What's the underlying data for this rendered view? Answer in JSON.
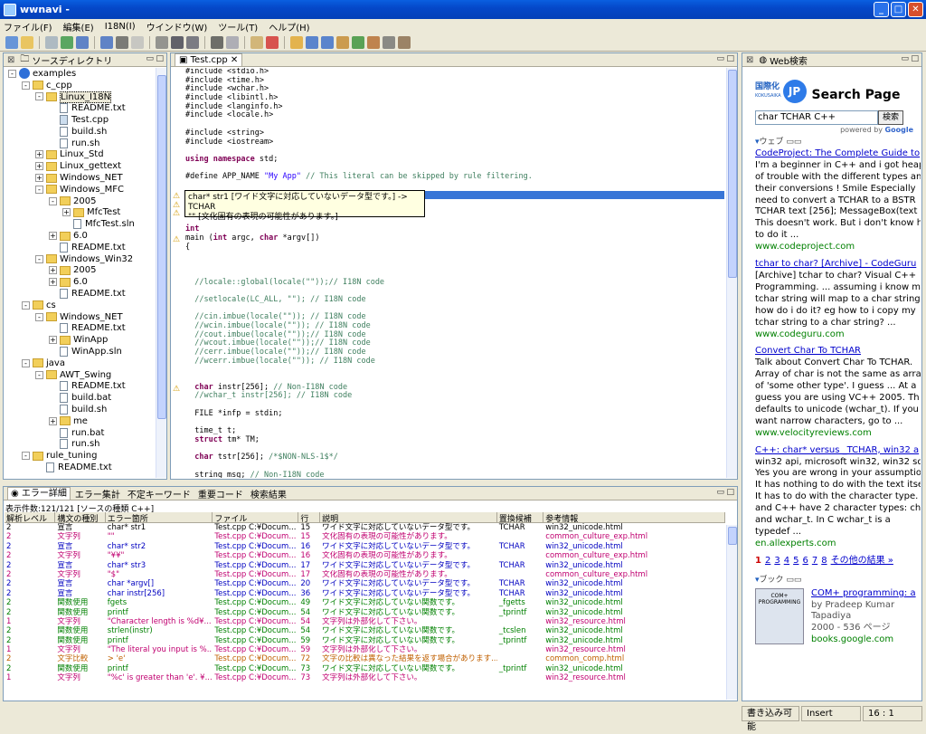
{
  "window": {
    "title": "wwnavi - "
  },
  "menu": [
    "ファイル(F)",
    "編集(E)",
    "I18N(I)",
    "ウインドウ(W)",
    "ツール(T)",
    "ヘルプ(H)"
  ],
  "toolbar_icons": [
    "new-icon",
    "open-icon",
    "save-icon",
    "refresh-icon",
    "redo-icon",
    "undo-icon",
    "binoculars-icon",
    "stop-icon",
    "gear-icon",
    "monitor-icon",
    "printer-icon",
    "scissors-icon",
    "copy-icon",
    "paste-icon",
    "delete-icon",
    "link-icon",
    "globe-icon",
    "globe2-icon",
    "book-icon",
    "tree-icon",
    "image-icon",
    "tools-icon",
    "help-icon"
  ],
  "source_panel": {
    "title": "ソースディレクトリ",
    "tree": [
      {
        "d": 0,
        "t": "proj",
        "exp": "-",
        "label": "examples"
      },
      {
        "d": 1,
        "t": "folder",
        "exp": "-",
        "label": "c_cpp"
      },
      {
        "d": 2,
        "t": "folder",
        "exp": "-",
        "label": "Linux_I18N",
        "sel": true
      },
      {
        "d": 3,
        "t": "file",
        "label": "README.txt"
      },
      {
        "d": 3,
        "t": "cfile",
        "label": "Test.cpp"
      },
      {
        "d": 3,
        "t": "file",
        "label": "build.sh"
      },
      {
        "d": 3,
        "t": "file",
        "label": "run.sh"
      },
      {
        "d": 2,
        "t": "folder",
        "exp": "+",
        "label": "Linux_Std"
      },
      {
        "d": 2,
        "t": "folder",
        "exp": "+",
        "label": "Linux_gettext"
      },
      {
        "d": 2,
        "t": "folder",
        "exp": "+",
        "label": "Windows_NET"
      },
      {
        "d": 2,
        "t": "folder",
        "exp": "-",
        "label": "Windows_MFC"
      },
      {
        "d": 3,
        "t": "folder",
        "exp": "-",
        "label": "2005"
      },
      {
        "d": 4,
        "t": "folder",
        "exp": "+",
        "label": "MfcTest"
      },
      {
        "d": 4,
        "t": "file",
        "label": "MfcTest.sln"
      },
      {
        "d": 3,
        "t": "folder",
        "exp": "+",
        "label": "6.0"
      },
      {
        "d": 3,
        "t": "file",
        "label": "README.txt"
      },
      {
        "d": 2,
        "t": "folder",
        "exp": "-",
        "label": "Windows_Win32"
      },
      {
        "d": 3,
        "t": "folder",
        "exp": "+",
        "label": "2005"
      },
      {
        "d": 3,
        "t": "folder",
        "exp": "+",
        "label": "6.0"
      },
      {
        "d": 3,
        "t": "file",
        "label": "README.txt"
      },
      {
        "d": 1,
        "t": "folder",
        "exp": "-",
        "label": "cs"
      },
      {
        "d": 2,
        "t": "folder",
        "exp": "-",
        "label": "Windows_NET"
      },
      {
        "d": 3,
        "t": "file",
        "label": "README.txt"
      },
      {
        "d": 3,
        "t": "folder",
        "exp": "+",
        "label": "WinApp"
      },
      {
        "d": 3,
        "t": "file",
        "label": "WinApp.sln"
      },
      {
        "d": 1,
        "t": "folder",
        "exp": "-",
        "label": "java"
      },
      {
        "d": 2,
        "t": "folder",
        "exp": "-",
        "label": "AWT_Swing"
      },
      {
        "d": 3,
        "t": "file",
        "label": "README.txt"
      },
      {
        "d": 3,
        "t": "file",
        "label": "build.bat"
      },
      {
        "d": 3,
        "t": "file",
        "label": "build.sh"
      },
      {
        "d": 3,
        "t": "folder",
        "exp": "+",
        "label": "me"
      },
      {
        "d": 3,
        "t": "file",
        "label": "run.bat"
      },
      {
        "d": 3,
        "t": "file",
        "label": "run.sh"
      },
      {
        "d": 1,
        "t": "folder",
        "exp": "-",
        "label": "rule_tuning"
      },
      {
        "d": 2,
        "t": "file",
        "label": "README.txt"
      }
    ]
  },
  "editor": {
    "tab": "Test.cpp",
    "lines": [
      [
        [
          "",
          "#include <stdio.h>"
        ]
      ],
      [
        [
          "",
          "#include <time.h>"
        ]
      ],
      [
        [
          "",
          "#include <wchar.h>"
        ]
      ],
      [
        [
          "",
          "#include <libintl.h>"
        ]
      ],
      [
        [
          "",
          "#include <langinfo.h>"
        ]
      ],
      [
        [
          "",
          "#include <locale.h>"
        ]
      ],
      [
        [
          "",
          ""
        ]
      ],
      [
        [
          "",
          "#include <string>"
        ]
      ],
      [
        [
          "",
          "#include <iostream>"
        ]
      ],
      [
        [
          "",
          ""
        ]
      ],
      [
        [
          "kw",
          "using namespace"
        ],
        [
          "",
          " std;"
        ]
      ],
      [
        [
          "",
          ""
        ]
      ],
      [
        [
          "",
          "#define APP_NAME "
        ],
        [
          "str",
          "\"My App\""
        ],
        [
          "cm",
          " // This literal can be skipped by rule filtering."
        ]
      ],
      [
        [
          "",
          ""
        ]
      ],
      [
        [
          "",
          "char* str1"
        ]
      ],
      [
        [
          "",
          ""
        ]
      ],
      [
        [
          "",
          ""
        ]
      ],
      [
        [
          "",
          ""
        ]
      ],
      [
        [
          "kw",
          "int"
        ]
      ],
      [
        [
          "",
          "main ("
        ],
        [
          "kw",
          "int"
        ],
        [
          "",
          " argc, "
        ],
        [
          "kw",
          "char"
        ],
        [
          "",
          " *argv[])"
        ]
      ],
      [
        [
          "",
          "{"
        ]
      ],
      [
        [
          "",
          ""
        ]
      ],
      [
        [
          "",
          ""
        ]
      ],
      [
        [
          "",
          ""
        ]
      ],
      [
        [
          "cm",
          "  //locale::global(locale(\"\"));// I18N code"
        ]
      ],
      [
        [
          "",
          ""
        ]
      ],
      [
        [
          "cm",
          "  //setlocale(LC_ALL, \"\"); // I18N code"
        ]
      ],
      [
        [
          "",
          ""
        ]
      ],
      [
        [
          "cm",
          "  //cin.imbue(locale(\"\")); // I18N code"
        ]
      ],
      [
        [
          "cm",
          "  //wcin.imbue(locale(\"\")); // I18N code"
        ]
      ],
      [
        [
          "cm",
          "  //cout.imbue(locale(\"\"));// I18N code"
        ]
      ],
      [
        [
          "cm",
          "  //wcout.imbue(locale(\"\"));// I18N code"
        ]
      ],
      [
        [
          "cm",
          "  //cerr.imbue(locale(\"\"));// I18N code"
        ]
      ],
      [
        [
          "cm",
          "  //wcerr.imbue(locale(\"\")); // I18N code"
        ]
      ],
      [
        [
          "",
          ""
        ]
      ],
      [
        [
          "",
          ""
        ]
      ],
      [
        [
          "kw",
          "  char"
        ],
        [
          "",
          " instr[256]; "
        ],
        [
          "cm",
          "// Non-I18N code"
        ]
      ],
      [
        [
          "cm",
          "  //wchar_t instr[256]; // I18N code"
        ]
      ],
      [
        [
          "",
          ""
        ]
      ],
      [
        [
          "",
          "  FILE *infp = stdin;"
        ]
      ],
      [
        [
          "",
          ""
        ]
      ],
      [
        [
          "",
          "  time_t t;"
        ]
      ],
      [
        [
          "kw",
          "  struct"
        ],
        [
          "",
          " tm* TM;"
        ]
      ],
      [
        [
          "",
          ""
        ]
      ],
      [
        [
          "kw",
          "  char"
        ],
        [
          "",
          " tstr[256]; "
        ],
        [
          "cm",
          "/*$NON-NLS-1$*/"
        ]
      ],
      [
        [
          "",
          ""
        ]
      ],
      [
        [
          "",
          "  string msg; "
        ],
        [
          "cm",
          "// Non-I18N code"
        ]
      ]
    ],
    "tooltip": [
      "char* str1 [ワイド文字に対応していないデータ型です。] -> TCHAR",
      "\"\" [文化固有の表現の可能性があります。]"
    ]
  },
  "error_panel": {
    "tabs": [
      "エラー詳細",
      "エラー集計",
      "不定キーワード",
      "重要コード",
      "検索結果"
    ],
    "info": "表示件数:121/121  [ソースの種類 C++]",
    "columns": [
      "解析レベル",
      "構文の種別",
      "エラー箇所",
      "ファイル",
      "行",
      "説明",
      "置換候補",
      "参考情報"
    ],
    "rows": [
      [
        "2",
        "宣言",
        "char* str1",
        "Test.cpp C:¥Docum...",
        "15",
        "ワイド文字に対応していないデータ型です。",
        "TCHAR",
        "win32_unicode.html",
        "#000"
      ],
      [
        "2",
        "文字列",
        "\"\"",
        "Test.cpp C:¥Docum...",
        "15",
        "文化固有の表現の可能性があります。",
        "",
        "common_culture_exp.html",
        "#c00070"
      ],
      [
        "2",
        "宣言",
        "char* str2",
        "Test.cpp C:¥Docum...",
        "16",
        "ワイド文字に対応していないデータ型です。",
        "TCHAR",
        "win32_unicode.html",
        "#0000c0"
      ],
      [
        "2",
        "文字列",
        "\"¥¥\"",
        "Test.cpp C:¥Docum...",
        "16",
        "文化固有の表現の可能性があります。",
        "",
        "common_culture_exp.html",
        "#c00070"
      ],
      [
        "2",
        "宣言",
        "char* str3",
        "Test.cpp C:¥Docum...",
        "17",
        "ワイド文字に対応していないデータ型です。",
        "TCHAR",
        "win32_unicode.html",
        "#0000c0"
      ],
      [
        "2",
        "文字列",
        "\"$\"",
        "Test.cpp C:¥Docum...",
        "17",
        "文化固有の表現の可能性があります。",
        "",
        "common_culture_exp.html",
        "#c00070"
      ],
      [
        "2",
        "宣言",
        "char *argv[]",
        "Test.cpp C:¥Docum...",
        "20",
        "ワイド文字に対応していないデータ型です。",
        "TCHAR",
        "win32_unicode.html",
        "#0000c0"
      ],
      [
        "2",
        "宣言",
        "char instr[256]",
        "Test.cpp C:¥Docum...",
        "36",
        "ワイド文字に対応していないデータ型です。",
        "TCHAR",
        "win32_unicode.html",
        "#0000c0"
      ],
      [
        "2",
        "関数使用",
        "fgets",
        "Test.cpp C:¥Docum...",
        "49",
        "ワイド文字に対応していない関数です。",
        "_fgetts",
        "win32_unicode.html",
        "#008000"
      ],
      [
        "2",
        "関数使用",
        "printf",
        "Test.cpp C:¥Docum...",
        "54",
        "ワイド文字に対応していない関数です。",
        "_tprintf",
        "win32_unicode.html",
        "#008000"
      ],
      [
        "1",
        "文字列",
        "\"Character length is %d¥...",
        "Test.cpp C:¥Docum...",
        "54",
        "文字列は外部化して下さい。",
        "",
        "win32_resource.html",
        "#c00070"
      ],
      [
        "2",
        "関数使用",
        "strlen(instr)",
        "Test.cpp C:¥Docum...",
        "54",
        "ワイド文字に対応していない関数です。",
        "_tcslen",
        "win32_unicode.html",
        "#008000"
      ],
      [
        "2",
        "関数使用",
        "printf",
        "Test.cpp C:¥Docum...",
        "59",
        "ワイド文字に対応していない関数です。",
        "_tprintf",
        "win32_unicode.html",
        "#008000"
      ],
      [
        "1",
        "文字列",
        "\"The literal you input is %...",
        "Test.cpp C:¥Docum...",
        "59",
        "文字列は外部化して下さい。",
        "",
        "win32_resource.html",
        "#c00070"
      ],
      [
        "2",
        "文字比較",
        "> 'e'",
        "Test.cpp C:¥Docum...",
        "72",
        "文字の比較は異なった結果を返す場合があります...",
        "",
        "common_comp.html",
        "#c06000"
      ],
      [
        "2",
        "関数使用",
        "printf",
        "Test.cpp C:¥Docum...",
        "73",
        "ワイド文字に対応していない関数です。",
        "_tprintf",
        "win32_unicode.html",
        "#008000"
      ],
      [
        "1",
        "文字列",
        "\"%c' is greater than 'e'. ¥...",
        "Test.cpp C:¥Docum...",
        "73",
        "文字列は外部化して下さい。",
        "",
        "win32_resource.html",
        "#c00070"
      ]
    ]
  },
  "web_panel": {
    "title": "Web検索",
    "logo": "国際化",
    "logo_sub": "KOKUSAIKA",
    "logo_jp": "JP",
    "page_title": "Search Page",
    "search_value": "char TCHAR C++",
    "search_button": "検索",
    "powered": "powered by",
    "google": "Google",
    "section_web": "ウェブ",
    "section_book": "ブック",
    "results": [
      {
        "title": "CodeProject: The Complete Guide to",
        "lines": [
          "I'm a beginner in C++ and i got heap",
          "of trouble with the different types and",
          "their conversions ! Smile Especially",
          "need to convert a TCHAR to a BSTR",
          "TCHAR text [256]; MessageBox(text",
          "This doesn't work. But i don't know h",
          "to do it ..."
        ],
        "url": "www.codeproject.com"
      },
      {
        "title": "tchar to char? [Archive] - CodeGuru",
        "lines": [
          "[Archive] tchar to char? Visual C++",
          "Programming. ... assuming i know m",
          "tchar string will map to a char string",
          "how do i do it? eg how to i copy my",
          "tchar string to a char string? ..."
        ],
        "url": "www.codeguru.com"
      },
      {
        "title": "Convert Char To TCHAR",
        "lines": [
          "Talk about Convert Char To TCHAR.",
          "Array of char is not the same as arra",
          "of 'some other type'. I guess ... At a",
          "guess you are using VC++ 2005. Th",
          "defaults to unicode (wchar_t). If you",
          "want narrow characters, go to ..."
        ],
        "url": "www.velocityreviews.com"
      },
      {
        "title": "C++: char* versus _TCHAR, win32 a",
        "lines": [
          "win32 api, microsoft win32, win32 sd",
          "Yes you are wrong in your assumptio",
          "It has nothing to do with the text itse",
          "It has to do with the character type.",
          "and C++ have 2 character types: ch",
          "and wchar_t. In C wchar_t is a",
          "typedef ..."
        ],
        "url": "en.allexperts.com"
      }
    ],
    "pages": [
      "1",
      "2",
      "3",
      "4",
      "5",
      "6",
      "7",
      "8"
    ],
    "more": "その他の結果 »",
    "book": {
      "title": "COM+ programming: a",
      "author": "by Pradeep Kumar",
      "author2": "Tapadiya",
      "meta": "2000 - 536 ページ",
      "url": "books.google.com",
      "cover": "COM+ PROGRAMMING"
    }
  },
  "status": {
    "mode": "書き込み可能",
    "insert": "Insert",
    "pos": "16 : 1"
  }
}
